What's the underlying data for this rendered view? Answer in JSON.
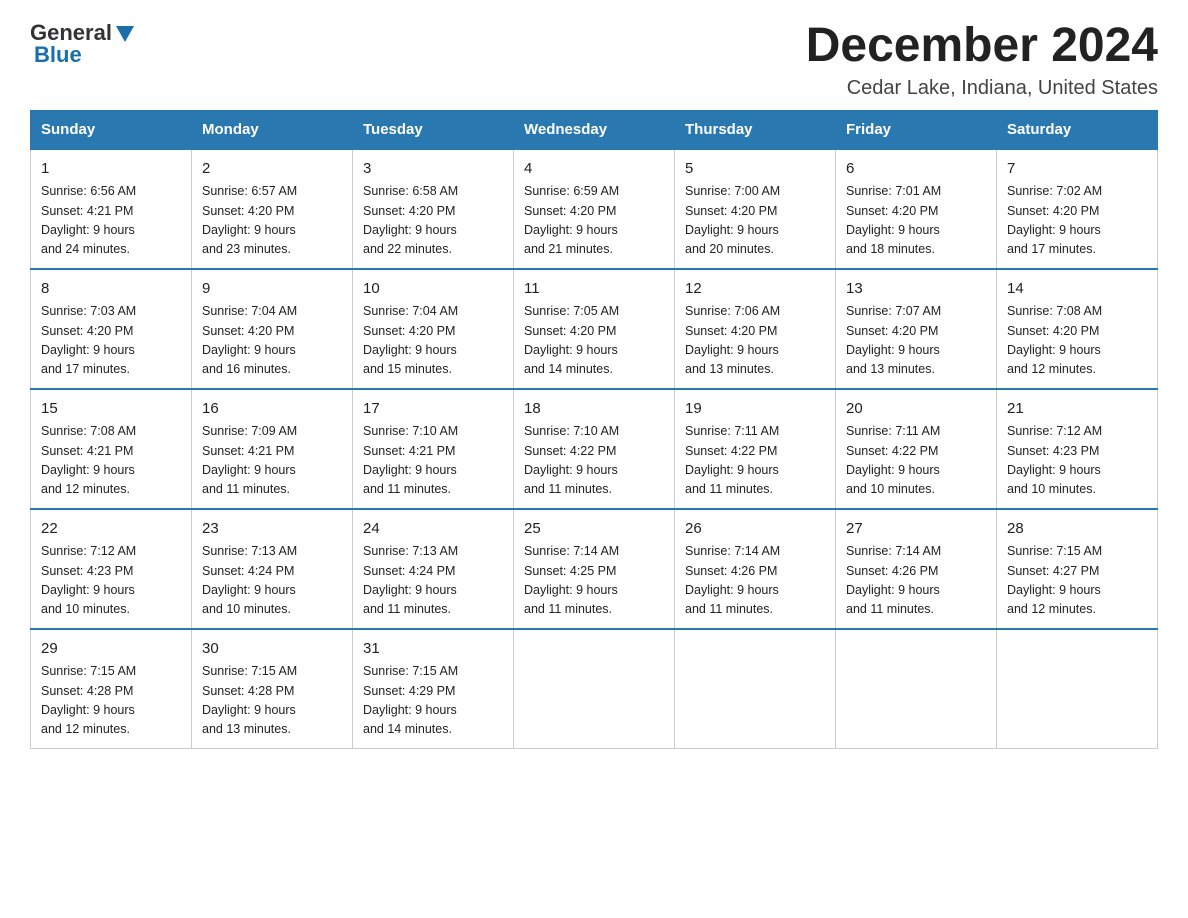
{
  "header": {
    "logo_general": "General",
    "logo_blue": "Blue",
    "month_title": "December 2024",
    "location": "Cedar Lake, Indiana, United States"
  },
  "days_of_week": [
    "Sunday",
    "Monday",
    "Tuesday",
    "Wednesday",
    "Thursday",
    "Friday",
    "Saturday"
  ],
  "weeks": [
    [
      {
        "num": "1",
        "sunrise": "6:56 AM",
        "sunset": "4:21 PM",
        "daylight": "9 hours and 24 minutes."
      },
      {
        "num": "2",
        "sunrise": "6:57 AM",
        "sunset": "4:20 PM",
        "daylight": "9 hours and 23 minutes."
      },
      {
        "num": "3",
        "sunrise": "6:58 AM",
        "sunset": "4:20 PM",
        "daylight": "9 hours and 22 minutes."
      },
      {
        "num": "4",
        "sunrise": "6:59 AM",
        "sunset": "4:20 PM",
        "daylight": "9 hours and 21 minutes."
      },
      {
        "num": "5",
        "sunrise": "7:00 AM",
        "sunset": "4:20 PM",
        "daylight": "9 hours and 20 minutes."
      },
      {
        "num": "6",
        "sunrise": "7:01 AM",
        "sunset": "4:20 PM",
        "daylight": "9 hours and 18 minutes."
      },
      {
        "num": "7",
        "sunrise": "7:02 AM",
        "sunset": "4:20 PM",
        "daylight": "9 hours and 17 minutes."
      }
    ],
    [
      {
        "num": "8",
        "sunrise": "7:03 AM",
        "sunset": "4:20 PM",
        "daylight": "9 hours and 17 minutes."
      },
      {
        "num": "9",
        "sunrise": "7:04 AM",
        "sunset": "4:20 PM",
        "daylight": "9 hours and 16 minutes."
      },
      {
        "num": "10",
        "sunrise": "7:04 AM",
        "sunset": "4:20 PM",
        "daylight": "9 hours and 15 minutes."
      },
      {
        "num": "11",
        "sunrise": "7:05 AM",
        "sunset": "4:20 PM",
        "daylight": "9 hours and 14 minutes."
      },
      {
        "num": "12",
        "sunrise": "7:06 AM",
        "sunset": "4:20 PM",
        "daylight": "9 hours and 13 minutes."
      },
      {
        "num": "13",
        "sunrise": "7:07 AM",
        "sunset": "4:20 PM",
        "daylight": "9 hours and 13 minutes."
      },
      {
        "num": "14",
        "sunrise": "7:08 AM",
        "sunset": "4:20 PM",
        "daylight": "9 hours and 12 minutes."
      }
    ],
    [
      {
        "num": "15",
        "sunrise": "7:08 AM",
        "sunset": "4:21 PM",
        "daylight": "9 hours and 12 minutes."
      },
      {
        "num": "16",
        "sunrise": "7:09 AM",
        "sunset": "4:21 PM",
        "daylight": "9 hours and 11 minutes."
      },
      {
        "num": "17",
        "sunrise": "7:10 AM",
        "sunset": "4:21 PM",
        "daylight": "9 hours and 11 minutes."
      },
      {
        "num": "18",
        "sunrise": "7:10 AM",
        "sunset": "4:22 PM",
        "daylight": "9 hours and 11 minutes."
      },
      {
        "num": "19",
        "sunrise": "7:11 AM",
        "sunset": "4:22 PM",
        "daylight": "9 hours and 11 minutes."
      },
      {
        "num": "20",
        "sunrise": "7:11 AM",
        "sunset": "4:22 PM",
        "daylight": "9 hours and 10 minutes."
      },
      {
        "num": "21",
        "sunrise": "7:12 AM",
        "sunset": "4:23 PM",
        "daylight": "9 hours and 10 minutes."
      }
    ],
    [
      {
        "num": "22",
        "sunrise": "7:12 AM",
        "sunset": "4:23 PM",
        "daylight": "9 hours and 10 minutes."
      },
      {
        "num": "23",
        "sunrise": "7:13 AM",
        "sunset": "4:24 PM",
        "daylight": "9 hours and 10 minutes."
      },
      {
        "num": "24",
        "sunrise": "7:13 AM",
        "sunset": "4:24 PM",
        "daylight": "9 hours and 11 minutes."
      },
      {
        "num": "25",
        "sunrise": "7:14 AM",
        "sunset": "4:25 PM",
        "daylight": "9 hours and 11 minutes."
      },
      {
        "num": "26",
        "sunrise": "7:14 AM",
        "sunset": "4:26 PM",
        "daylight": "9 hours and 11 minutes."
      },
      {
        "num": "27",
        "sunrise": "7:14 AM",
        "sunset": "4:26 PM",
        "daylight": "9 hours and 11 minutes."
      },
      {
        "num": "28",
        "sunrise": "7:15 AM",
        "sunset": "4:27 PM",
        "daylight": "9 hours and 12 minutes."
      }
    ],
    [
      {
        "num": "29",
        "sunrise": "7:15 AM",
        "sunset": "4:28 PM",
        "daylight": "9 hours and 12 minutes."
      },
      {
        "num": "30",
        "sunrise": "7:15 AM",
        "sunset": "4:28 PM",
        "daylight": "9 hours and 13 minutes."
      },
      {
        "num": "31",
        "sunrise": "7:15 AM",
        "sunset": "4:29 PM",
        "daylight": "9 hours and 14 minutes."
      },
      null,
      null,
      null,
      null
    ]
  ],
  "labels": {
    "sunrise": "Sunrise:",
    "sunset": "Sunset:",
    "daylight": "Daylight:"
  }
}
